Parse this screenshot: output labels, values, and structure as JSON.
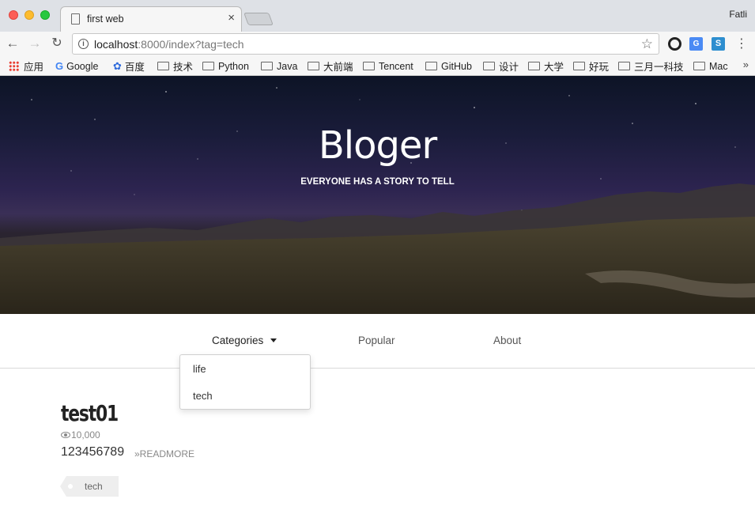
{
  "browser": {
    "tab_title": "first web",
    "tab_close": "×",
    "profile_name": "Fatli",
    "url_host": "localhost",
    "url_rest": ":8000/index?tag=tech",
    "icons": {
      "back": "arrow-left-icon",
      "forward": "arrow-right-icon",
      "reload": "reload-icon",
      "info": "info-icon",
      "star": "star-icon",
      "menu": "kebab-menu-icon"
    },
    "bookmarks": {
      "apps": "应用",
      "items": [
        "Google",
        "百度",
        "技术",
        "Python",
        "Java",
        "大前端",
        "Tencent",
        "GitHub",
        "设计",
        "大学",
        "好玩",
        "三月一科技",
        "Mac"
      ],
      "more": "»"
    }
  },
  "hero": {
    "title": "Bloger",
    "subtitle": "EVERYONE HAS A STORY TO TELL"
  },
  "nav": {
    "categories": "Categories",
    "popular": "Popular",
    "about": "About",
    "dropdown_items": [
      "life",
      "tech"
    ]
  },
  "post": {
    "title": "test01",
    "views": "10,000",
    "excerpt": "123456789",
    "readmore": "»READMORE",
    "tag": "tech"
  },
  "colors": {
    "titlebar": "#dee1e6",
    "toolbar": "#f6f6f6",
    "hero_top": "#0d1426",
    "hero_mid": "#2d2450",
    "text_dark": "#222222",
    "tag_bg": "#eeeeee"
  }
}
